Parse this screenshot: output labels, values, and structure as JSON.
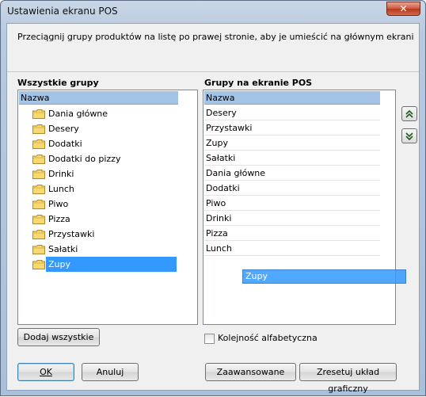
{
  "window": {
    "title": "Ustawienia ekranu POS",
    "close_glyph": "✕"
  },
  "instruction": "Przeciągnij grupy produktów na listę po prawej stronie, aby je umieścić na głównym ekranie termi",
  "all_groups": {
    "label": "Wszystkie grupy",
    "header": "Nazwa",
    "root_icon": "folder-icon",
    "items": [
      "Dania główne",
      "Desery",
      "Dodatki",
      "Dodatki do pizzy",
      "Drinki",
      "Lunch",
      "Piwo",
      "Pizza",
      "Przystawki",
      "Sałatki",
      "Zupy"
    ],
    "selected": "Zupy"
  },
  "pos_groups": {
    "label": "Grupy na ekranie POS",
    "header": "Nazwa",
    "items": [
      "Desery",
      "Przystawki",
      "Zupy",
      "Sałatki",
      "Dania główne",
      "Dodatki",
      "Piwo",
      "Drinki",
      "Pizza",
      "Lunch"
    ]
  },
  "drag_ghost": "Zupy",
  "buttons": {
    "add_all": "Dodaj wszystkie",
    "ok": "OK",
    "cancel": "Anuluj",
    "advanced": "Zaawansowane",
    "reset_layout": "Zresetuj układ graficzny"
  },
  "alphabetical": {
    "label": "Kolejność alfabetyczna",
    "checked": false
  },
  "colors": {
    "selection": "#3399ff",
    "header": "#a4c4e6"
  }
}
